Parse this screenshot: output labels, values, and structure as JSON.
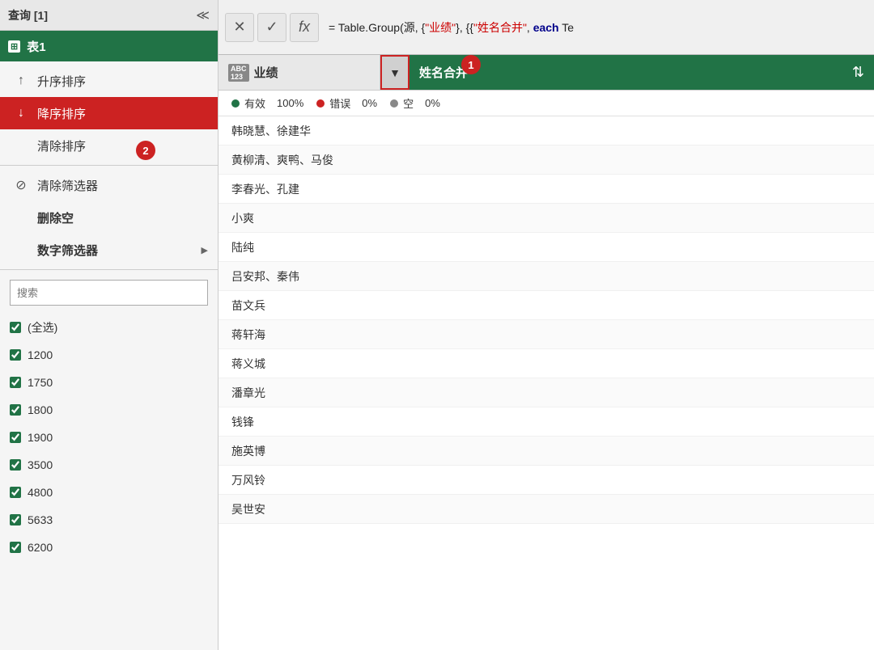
{
  "query": {
    "title": "查询 [1]",
    "table_name": "表1",
    "table_icon": "⊞"
  },
  "formula_bar": {
    "cancel_label": "✕",
    "confirm_label": "✓",
    "fx_label": "fx",
    "formula_text": "= Table.Group(源, {\"业绩\"}, {{\"姓名合并\", each Te"
  },
  "menu": {
    "sort_asc_label": "升序排序",
    "sort_desc_label": "降序排序",
    "clear_sort_label": "清除排序",
    "clear_filter_label": "清除筛选器",
    "delete_empty_label": "删除空",
    "number_filter_label": "数字筛选器",
    "search_placeholder": "搜索",
    "checkboxes": [
      {
        "label": "(全选)",
        "checked": true
      },
      {
        "label": "1200",
        "checked": true
      },
      {
        "label": "1750",
        "checked": true
      },
      {
        "label": "1800",
        "checked": true
      },
      {
        "label": "1900",
        "checked": true
      },
      {
        "label": "3500",
        "checked": true
      },
      {
        "label": "4800",
        "checked": true
      },
      {
        "label": "5633",
        "checked": true
      },
      {
        "label": "6200",
        "checked": true
      }
    ]
  },
  "table": {
    "col_yj_label": "业绩",
    "col_mc_label": "姓名合并",
    "stats": [
      {
        "label": "有效",
        "pct": "100%",
        "dot_class": "dot-valid"
      },
      {
        "label": "错误",
        "pct": "0%",
        "dot_class": "dot-error"
      },
      {
        "label": "空",
        "pct": "0%",
        "dot_class": "dot-empty"
      }
    ],
    "rows": [
      "韩晓慧、徐建华",
      "黄柳清、爽鸭、马俊",
      "李春光、孔建",
      "小爽",
      "陆纯",
      "吕安邦、秦伟",
      "苗文兵",
      "蒋轩海",
      "蒋义城",
      "潘章光",
      "钱锋",
      "施英博",
      "万风铃",
      "吴世安"
    ]
  },
  "badges": {
    "badge1_label": "1",
    "badge2_label": "2"
  },
  "colors": {
    "green": "#217346",
    "red": "#cc2222",
    "teal_header": "#00b0b0"
  }
}
